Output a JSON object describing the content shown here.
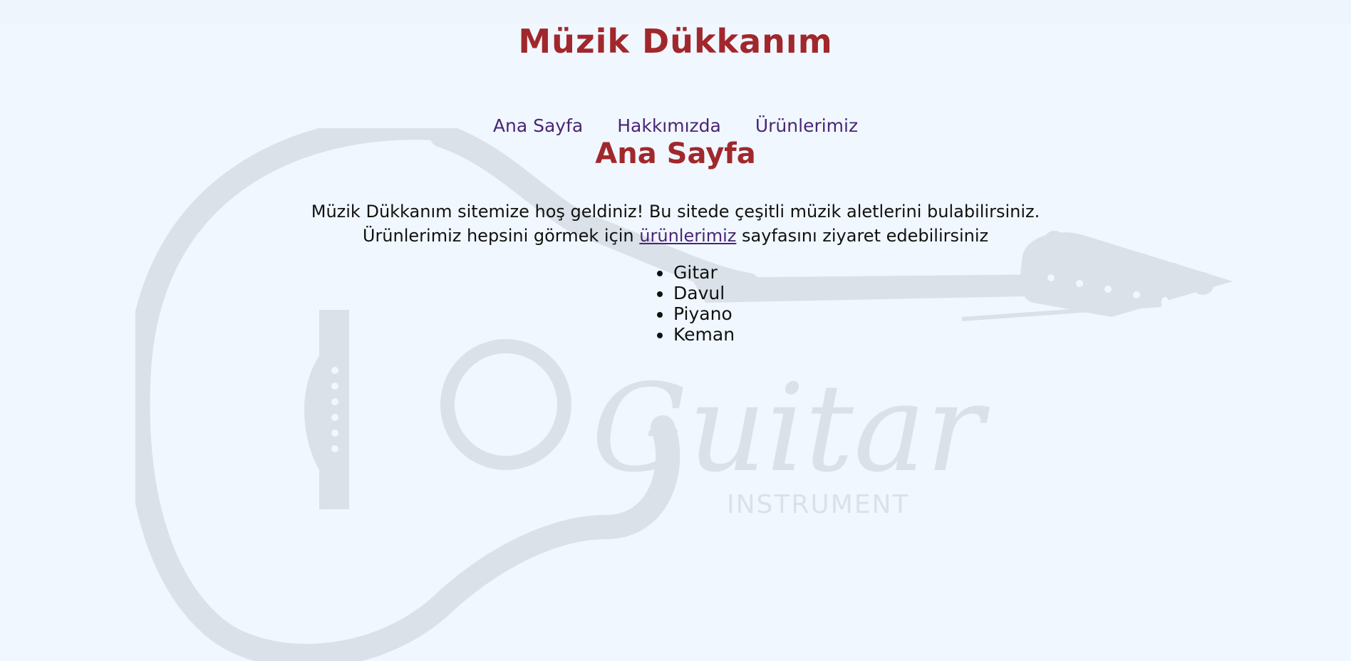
{
  "site": {
    "title": "Müzik Dükkanım"
  },
  "nav": {
    "items": [
      {
        "label": "Ana Sayfa"
      },
      {
        "label": "Hakkımızda"
      },
      {
        "label": "Ürünlerimiz"
      }
    ]
  },
  "main": {
    "heading": "Ana Sayfa",
    "intro_line1": "Müzik Dükkanım sitemize hoş geldiniz! Bu sitede çeşitli müzik aletlerini bulabilirsiniz.",
    "intro_line2_before": "Ürünlerimiz hepsini görmek için ",
    "intro_link": "ürünlerimiz",
    "intro_line2_after": " sayfasını ziyaret edebilirsiniz",
    "instruments": [
      "Gitar",
      "Davul",
      "Piyano",
      "Keman"
    ]
  },
  "watermark": {
    "word": "Guitar",
    "subword": "INSTRUMENT",
    "color": "#dae1e8"
  }
}
